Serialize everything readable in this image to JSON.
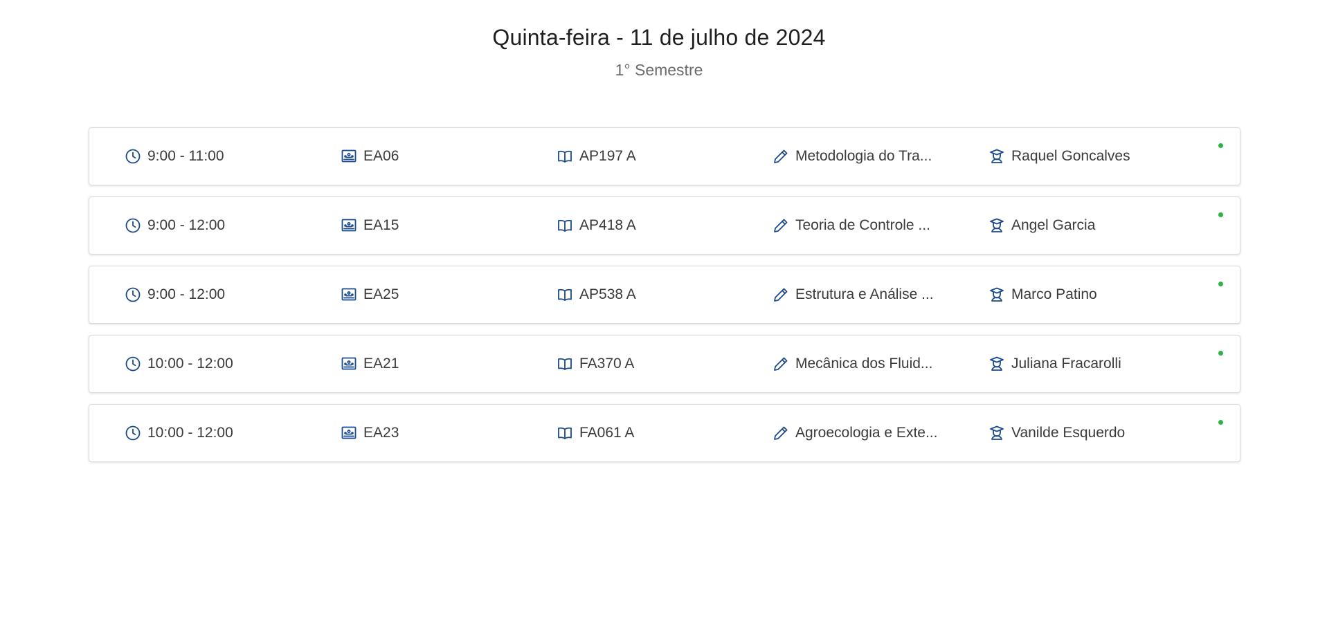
{
  "header": {
    "title": "Quinta-feira - 11 de julho de 2024",
    "subtitle": "1° Semestre"
  },
  "colors": {
    "icon": "#1a4a8a",
    "status_dot": "#2fb344"
  },
  "icons": {
    "time": "clock-icon",
    "room": "classroom-icon",
    "code": "book-icon",
    "subject": "pencil-icon",
    "teacher": "teacher-icon"
  },
  "classes": [
    {
      "time": "9:00 - 11:00",
      "room": "EA06",
      "code": "AP197 A",
      "subject": "Metodologia do Tra...",
      "teacher": "Raquel Goncalves",
      "status": "active"
    },
    {
      "time": "9:00 - 12:00",
      "room": "EA15",
      "code": "AP418 A",
      "subject": "Teoria de Controle ...",
      "teacher": "Angel Garcia",
      "status": "active"
    },
    {
      "time": "9:00 - 12:00",
      "room": "EA25",
      "code": "AP538 A",
      "subject": "Estrutura e Análise ...",
      "teacher": "Marco Patino",
      "status": "active"
    },
    {
      "time": "10:00 - 12:00",
      "room": "EA21",
      "code": "FA370 A",
      "subject": "Mecânica dos Fluid...",
      "teacher": "Juliana Fracarolli",
      "status": "active"
    },
    {
      "time": "10:00 - 12:00",
      "room": "EA23",
      "code": "FA061 A",
      "subject": "Agroecologia e Exte...",
      "teacher": "Vanilde Esquerdo",
      "status": "active"
    }
  ]
}
